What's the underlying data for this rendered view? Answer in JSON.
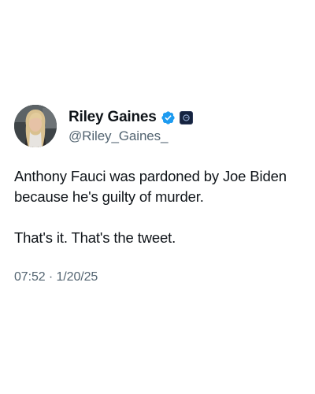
{
  "author": {
    "display_name": "Riley Gaines",
    "handle": "@Riley_Gaines_",
    "verified_color": "#1d9bf0",
    "affiliate_badge_color": "#15233f"
  },
  "tweet": {
    "paragraphs": [
      "Anthony Fauci was pardoned by Joe Biden because he's guilty of murder.",
      "That's it. That's the tweet."
    ],
    "time": "07:52",
    "separator": "·",
    "date": "1/20/25"
  }
}
